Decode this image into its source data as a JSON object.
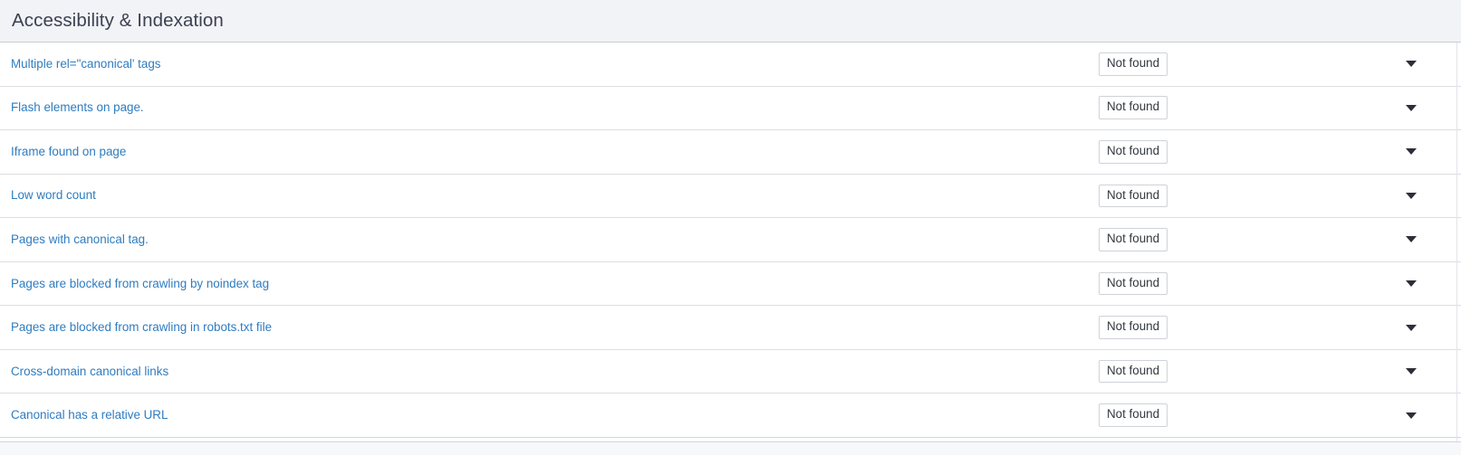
{
  "header": {
    "title": "Accessibility & Indexation"
  },
  "colors": {
    "header_bg": "#f2f3f7",
    "header_text": "#3c4152",
    "link": "#2e7cc0",
    "row_border": "#dcdee3",
    "status_text": "#33373f",
    "status_border": "#cfd2d8",
    "caret": "#2c2f36"
  },
  "icons": {
    "expand_caret": "caret-down-icon"
  },
  "rows": [
    {
      "label": "Multiple rel=\"canonical' tags",
      "status": "Not found"
    },
    {
      "label": "Flash elements on page.",
      "status": "Not found"
    },
    {
      "label": "Iframe found on page",
      "status": "Not found"
    },
    {
      "label": "Low word count",
      "status": "Not found"
    },
    {
      "label": "Pages with canonical tag.",
      "status": "Not found"
    },
    {
      "label": "Pages are blocked from crawling by noindex tag",
      "status": "Not found"
    },
    {
      "label": "Pages are blocked from crawling in robots.txt file",
      "status": "Not found"
    },
    {
      "label": "Cross-domain canonical links",
      "status": "Not found"
    },
    {
      "label": "Canonical has a relative URL",
      "status": "Not found"
    }
  ]
}
